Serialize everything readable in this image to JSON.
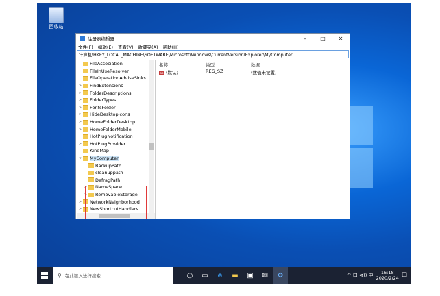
{
  "desktop": {
    "recycle_bin_label": "回收站"
  },
  "window": {
    "title": "注册表编辑器",
    "controls": {
      "minimize": "–",
      "maximize": "□",
      "close": "✕"
    },
    "menu": [
      "文件(F)",
      "编辑(E)",
      "查看(V)",
      "收藏夹(A)",
      "帮助(H)"
    ],
    "address": "计算机\\HKEY_LOCAL_MACHINE\\SOFTWARE\\Microsoft\\Windows\\CurrentVersion\\Explorer\\MyComputer"
  },
  "tree": {
    "items": [
      {
        "label": "FileAssociation",
        "expander": ""
      },
      {
        "label": "FileInUseResolver",
        "expander": ""
      },
      {
        "label": "FileOperationAdviseSinks",
        "expander": ""
      },
      {
        "label": "FindExtensions",
        "expander": ">"
      },
      {
        "label": "FolderDescriptions",
        "expander": ">"
      },
      {
        "label": "FolderTypes",
        "expander": ">"
      },
      {
        "label": "FontsFolder",
        "expander": ">"
      },
      {
        "label": "HideDesktopIcons",
        "expander": ">"
      },
      {
        "label": "HomeFolderDesktop",
        "expander": ">"
      },
      {
        "label": "HomeFolderMobile",
        "expander": ">"
      },
      {
        "label": "HotPlugNotification",
        "expander": ""
      },
      {
        "label": "HotPlugProvider",
        "expander": ">"
      },
      {
        "label": "KindMap",
        "expander": ""
      },
      {
        "label": "MyComputer",
        "expander": "v",
        "selected": true
      },
      {
        "label": "BackupPath",
        "expander": "",
        "child": true
      },
      {
        "label": "cleanuppath",
        "expander": "",
        "child": true
      },
      {
        "label": "DefragPath",
        "expander": "",
        "child": true
      },
      {
        "label": "NameSpace",
        "expander": ">",
        "child": true
      },
      {
        "label": "RemovableStorage",
        "expander": ">",
        "child": true
      },
      {
        "label": "NetworkNeighborhood",
        "expander": ">"
      },
      {
        "label": "NewShortcutHandlers",
        "expander": ">"
      }
    ]
  },
  "list": {
    "columns": [
      "名称",
      "类型",
      "数据"
    ],
    "rows": [
      {
        "name": "(默认)",
        "type": "REG_SZ",
        "data": "(数值未设置)",
        "icon_text": "ab"
      }
    ]
  },
  "taskbar": {
    "search_placeholder": "在此键入进行搜索",
    "icons": [
      "cortana-icon",
      "task-view-icon",
      "edge-icon",
      "file-explorer-icon",
      "store-icon",
      "mail-icon",
      "regedit-icon"
    ],
    "tray_text": "^ 口 ⊲)) 中",
    "time": "16:18",
    "date": "2020/2/24"
  }
}
